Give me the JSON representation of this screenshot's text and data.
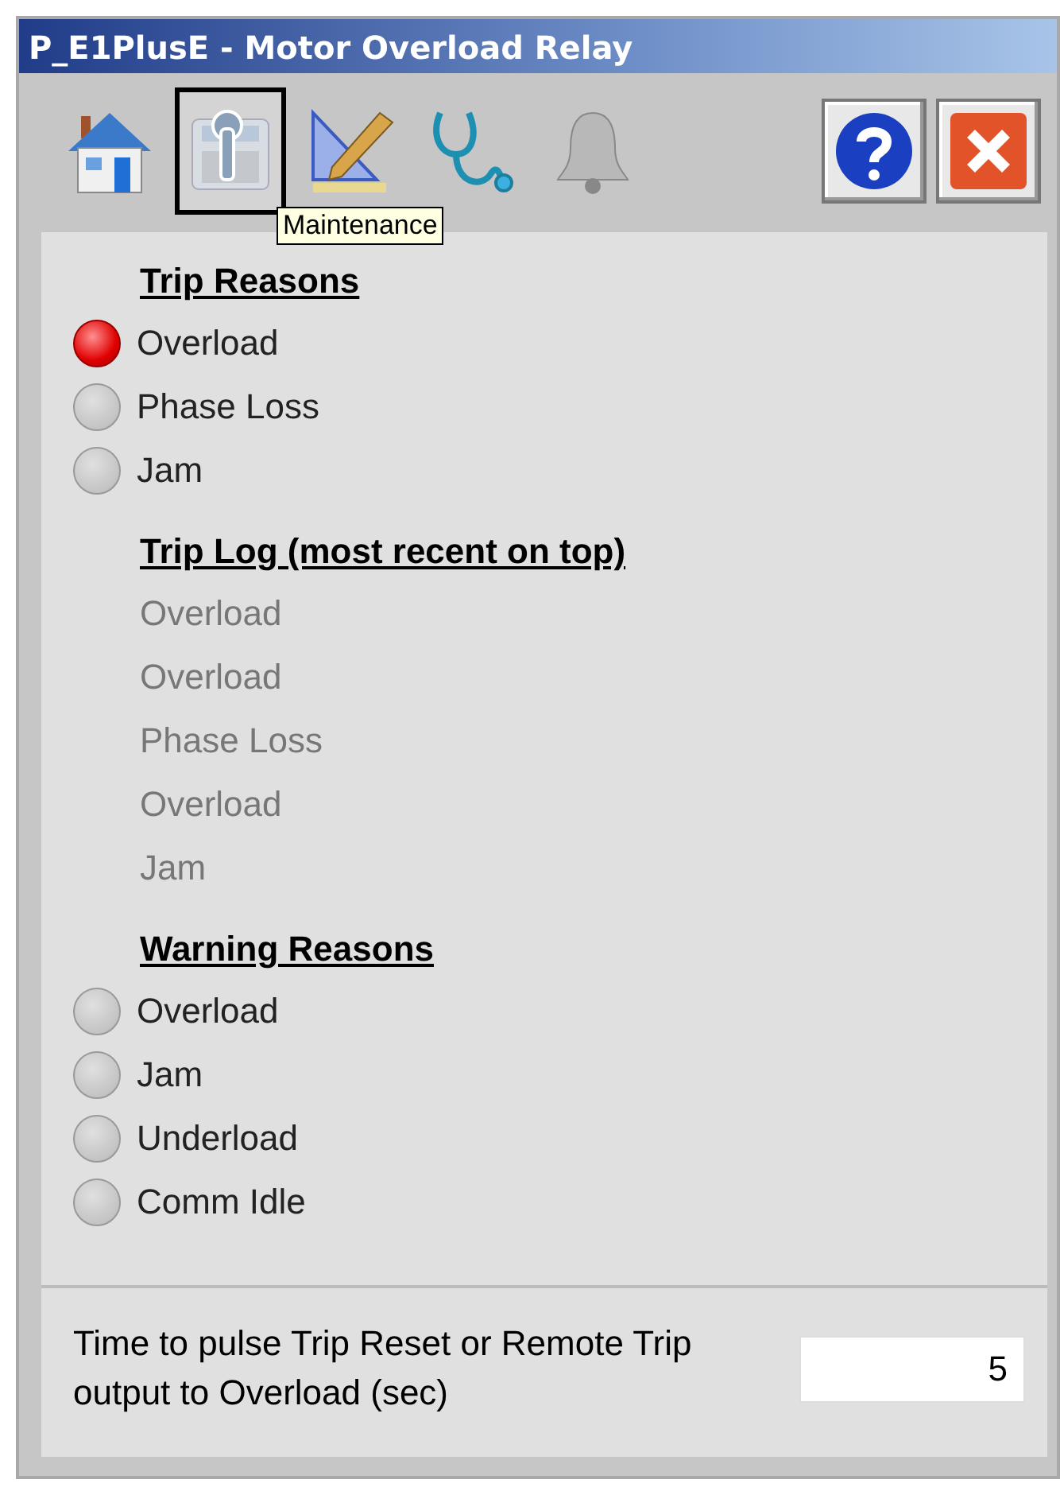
{
  "window": {
    "title": "P_E1PlusE - Motor Overload Relay"
  },
  "tabs": [
    {
      "kind": "home",
      "selected": false
    },
    {
      "kind": "maintenance",
      "selected": true
    },
    {
      "kind": "engineering",
      "selected": false
    },
    {
      "kind": "diagnostics",
      "selected": false
    },
    {
      "kind": "alarms",
      "selected": false
    }
  ],
  "tooltip": "Maintenance",
  "sections": [
    {
      "heading": "Trip Reasons",
      "kind": "indicators",
      "items": [
        {
          "label": "Overload",
          "on": true
        },
        {
          "label": "Phase Loss",
          "on": false
        },
        {
          "label": "Jam",
          "on": false
        }
      ]
    },
    {
      "heading": "Trip Log (most recent on top)",
      "kind": "log",
      "items": [
        {
          "label": "Overload"
        },
        {
          "label": "Overload"
        },
        {
          "label": "Phase Loss"
        },
        {
          "label": "Overload"
        },
        {
          "label": "Jam"
        }
      ]
    },
    {
      "heading": "Warning Reasons",
      "kind": "indicators",
      "items": [
        {
          "label": "Overload",
          "on": false
        },
        {
          "label": "Jam",
          "on": false
        },
        {
          "label": "Underload",
          "on": false
        },
        {
          "label": "Comm Idle",
          "on": false
        }
      ]
    }
  ],
  "setting": {
    "label": "Time to pulse Trip Reset or Remote Trip output to Overload (sec)",
    "value": "5"
  }
}
